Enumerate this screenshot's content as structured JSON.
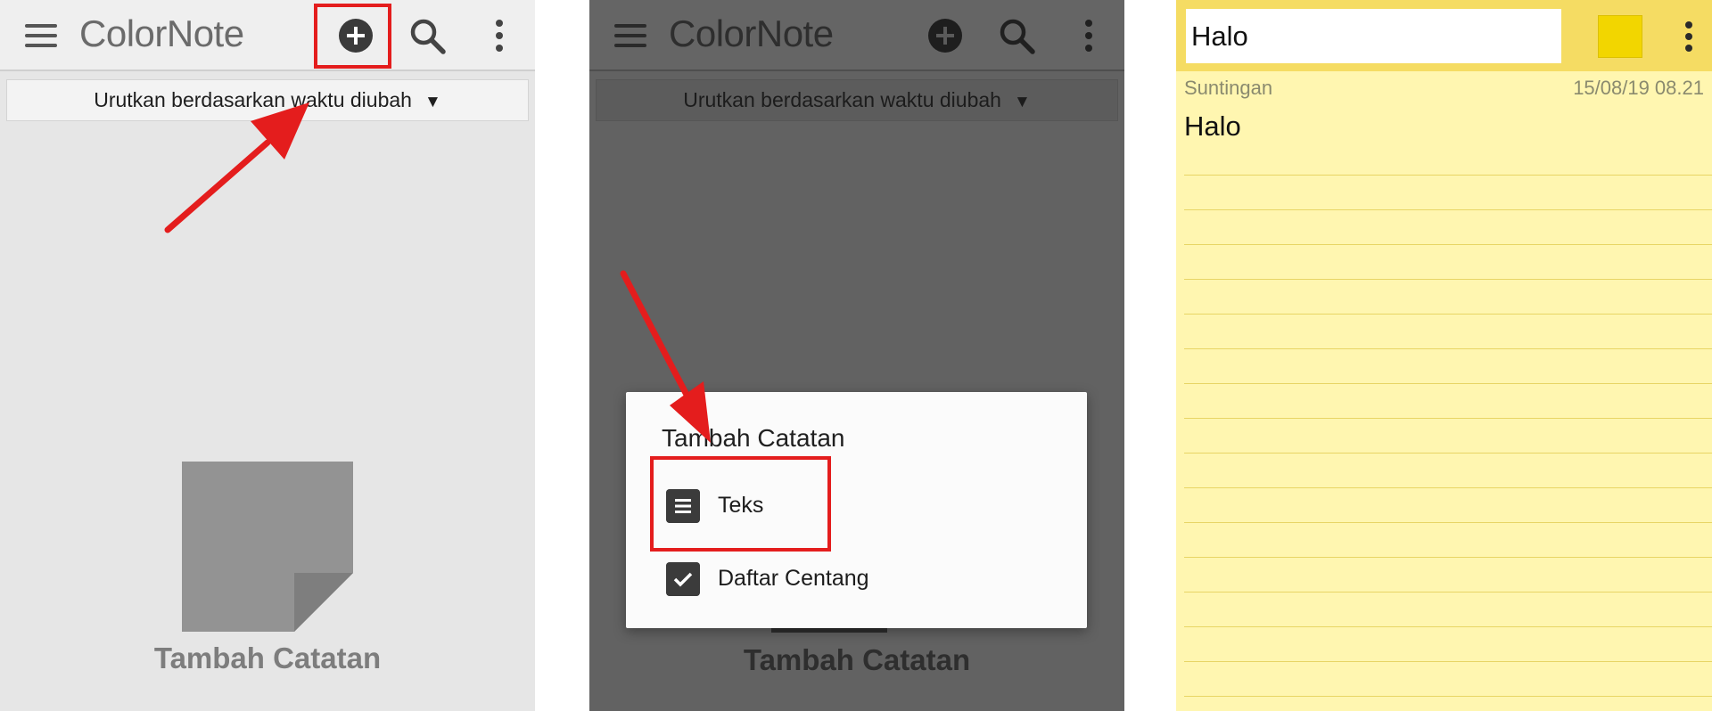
{
  "app": {
    "logo_text": "ColorNote"
  },
  "panel1": {
    "sort_label": "Urutkan berdasarkan waktu diubah",
    "caret": "▼",
    "empty_label": "Tambah Catatan"
  },
  "panel2": {
    "sort_label": "Urutkan berdasarkan waktu diubah",
    "caret": "▼",
    "empty_label": "Tambah Catatan",
    "dialog": {
      "title": "Tambah Catatan",
      "options": [
        {
          "label": "Teks",
          "icon": "text-note-icon"
        },
        {
          "label": "Daftar Centang",
          "icon": "checklist-icon"
        }
      ]
    }
  },
  "panel3": {
    "title_value": "Halo",
    "status": "Suntingan",
    "date": "15/08/19 08.21",
    "body": "Halo",
    "note_color": "#f2d600"
  },
  "annotation_color": "#e41d1d"
}
